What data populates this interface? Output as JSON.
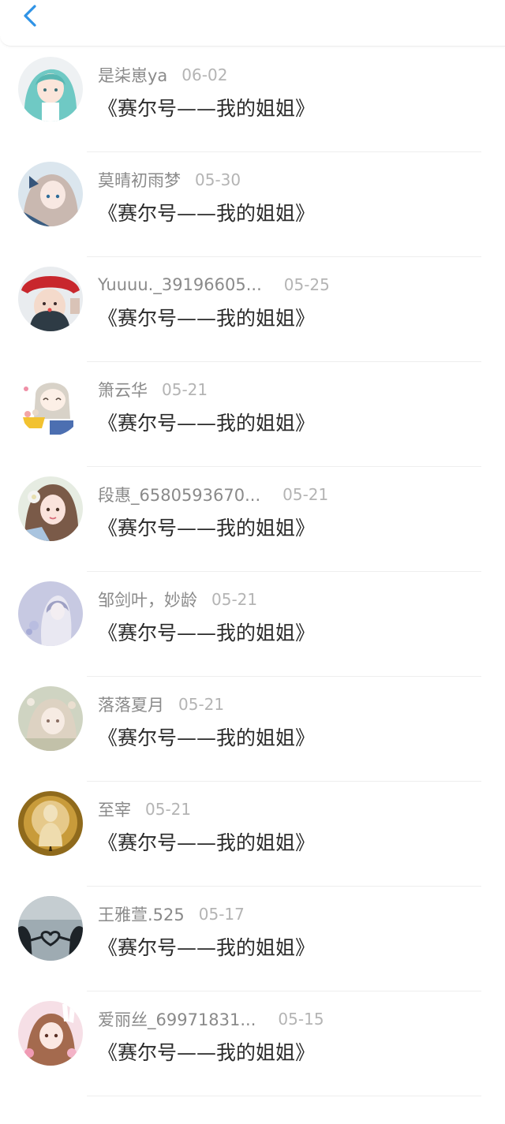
{
  "header": {
    "back_icon": "chevron-left-icon",
    "accent_color": "#2f93e6"
  },
  "comments": [
    {
      "user": "是柒崽ya",
      "date": "06-02",
      "text": "《赛尔号——我的姐姐》",
      "avatar_icon": "anime-girl-teal-hair-avatar"
    },
    {
      "user": "莫晴初雨梦",
      "date": "05-30",
      "text": "《赛尔号——我的姐姐》",
      "avatar_icon": "anime-girl-blue-bow-avatar"
    },
    {
      "user": "Yuuuu._39196605...",
      "date": "05-25",
      "text": "《赛尔号——我的姐姐》",
      "avatar_icon": "girl-red-hat-photo-avatar"
    },
    {
      "user": "箫云华",
      "date": "05-21",
      "text": "《赛尔号——我的姐姐》",
      "avatar_icon": "chibi-girl-sticker-avatar"
    },
    {
      "user": "段惠_6580593670...",
      "date": "05-21",
      "text": "《赛尔号——我的姐姐》",
      "avatar_icon": "girl-flower-hair-photo-avatar"
    },
    {
      "user": "邹剑叶，妙龄",
      "date": "05-21",
      "text": "《赛尔号——我的姐姐》",
      "avatar_icon": "lavender-girl-illustration-avatar"
    },
    {
      "user": "落落夏月",
      "date": "05-21",
      "text": "《赛尔号——我的姐姐》",
      "avatar_icon": "vintage-anime-girl-avatar"
    },
    {
      "user": "至宰",
      "date": "05-21",
      "text": "《赛尔号——我的姐姐》",
      "avatar_icon": "golden-figure-glow-avatar"
    },
    {
      "user": "王雅萱.525",
      "date": "05-17",
      "text": "《赛尔号——我的姐姐》",
      "avatar_icon": "silhouette-heart-hands-avatar"
    },
    {
      "user": "爱丽丝_69971831...",
      "date": "05-15",
      "text": "《赛尔号——我的姐姐》",
      "avatar_icon": "pink-bunny-girl-avatar"
    }
  ]
}
